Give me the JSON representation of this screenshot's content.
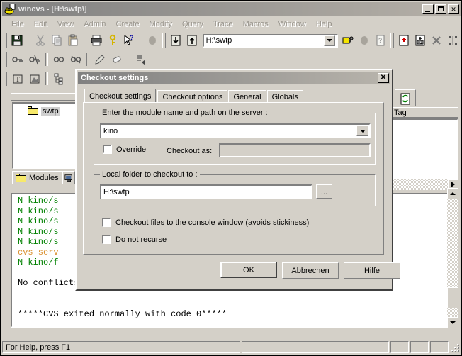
{
  "window": {
    "title": "wincvs - [H:\\swtp\\]",
    "app_icon": "wincvs-frog-icon",
    "minimize_label": "_",
    "maximize_label": "□",
    "close_label": "✕"
  },
  "menubar": {
    "items": [
      {
        "label": "File"
      },
      {
        "label": "Edit"
      },
      {
        "label": "View"
      },
      {
        "label": "Admin"
      },
      {
        "label": "Create"
      },
      {
        "label": "Modify"
      },
      {
        "label": "Query"
      },
      {
        "label": "Trace"
      },
      {
        "label": "Macros"
      },
      {
        "label": "Window"
      },
      {
        "label": "Help"
      }
    ]
  },
  "toolbar": {
    "row1": [
      {
        "icon": "save-icon",
        "name": "save-button"
      },
      {
        "icon": "cut-icon",
        "name": "cut-button"
      },
      {
        "icon": "copy-icon",
        "name": "copy-button"
      },
      {
        "icon": "paste-icon",
        "name": "paste-button"
      },
      {
        "icon": "print-icon",
        "name": "print-button"
      },
      {
        "icon": "about-key-icon",
        "name": "about-button"
      },
      {
        "icon": "help-pointer-icon",
        "name": "context-help-button"
      },
      {
        "icon": "stop-icon",
        "name": "stop-button"
      },
      {
        "icon": "checkout-down-icon",
        "name": "checkout-button"
      },
      {
        "icon": "commit-up-icon",
        "name": "commit-button"
      },
      {
        "icon": "browse-folder-icon",
        "name": "browse-folder-button"
      },
      {
        "icon": "stop2-icon",
        "name": "stop-alt-button"
      },
      {
        "icon": "query-icon",
        "name": "query-button"
      },
      {
        "icon": "add-icon",
        "name": "add-button"
      },
      {
        "icon": "add-binary-icon",
        "name": "add-binary-button"
      },
      {
        "icon": "remove-x-icon",
        "name": "remove-button"
      },
      {
        "icon": "graph-icon",
        "name": "graph-button"
      }
    ],
    "row2": [
      {
        "icon": "watch-on-icon",
        "name": "watch-on-button"
      },
      {
        "icon": "watch-off-icon",
        "name": "watch-off-button"
      },
      {
        "icon": "edit-glasses-icon",
        "name": "watchers-button"
      },
      {
        "icon": "unedit-glasses-icon",
        "name": "editors-button"
      },
      {
        "icon": "edit-pencil-icon",
        "name": "edit-button"
      },
      {
        "icon": "unedit-eraser-icon",
        "name": "unedit-button"
      },
      {
        "icon": "edit-list-icon",
        "name": "edit-list-button"
      }
    ],
    "row3": [
      {
        "icon": "text-t-icon",
        "name": "text-mode-button"
      },
      {
        "icon": "image-icon",
        "name": "image-mode-button"
      },
      {
        "icon": "tree-icon",
        "name": "tree-view-button"
      }
    ],
    "address": {
      "value": "H:\\swtp",
      "placeholder": ""
    }
  },
  "tree_panel": {
    "root_node": "swtp",
    "tabs": [
      {
        "label": "Modules",
        "icon": "folder-icon",
        "selected": true
      },
      {
        "label": "",
        "icon": "monitor-icon",
        "selected": false
      }
    ]
  },
  "tag_panel": {
    "tab_icon": "refresh-doc-icon",
    "column_header": "Tag",
    "rows": []
  },
  "console": {
    "lines": [
      {
        "text": "N kino/s",
        "color": "green"
      },
      {
        "text": "N kino/s",
        "color": "green"
      },
      {
        "text": "N kino/s",
        "color": "green"
      },
      {
        "text": "N kino/s",
        "color": "green"
      },
      {
        "text": "N kino/s",
        "color": "green"
      },
      {
        "text": "cvs serv",
        "color": "orange"
      },
      {
        "text": "N kino/f",
        "color": "green"
      },
      {
        "text": "",
        "color": "black"
      },
      {
        "text": "No conflicts created by this import",
        "color": "black"
      },
      {
        "text": "",
        "color": "black"
      },
      {
        "text": "",
        "color": "black"
      },
      {
        "text": "*****CVS exited normally with code 0*****",
        "color": "black"
      }
    ]
  },
  "dialog": {
    "title": "Checkout settings",
    "close_label": "✕",
    "tabs": [
      {
        "label": "Checkout settings",
        "selected": true
      },
      {
        "label": "Checkout options",
        "selected": false
      },
      {
        "label": "General",
        "selected": false
      },
      {
        "label": "Globals",
        "selected": false
      }
    ],
    "module_group": {
      "legend": "Enter the module name and path on the server :",
      "module_value": "kino",
      "module_placeholder": "",
      "override_label": "Override",
      "override_checked": false,
      "checkout_as_label": "Checkout as:",
      "checkout_as_value": "",
      "checkout_as_placeholder": ""
    },
    "folder_group": {
      "legend": "Local folder to checkout to :",
      "folder_value": "H:\\swtp",
      "folder_placeholder": "",
      "browse_label": "..."
    },
    "options": [
      {
        "label": "Checkout files to the console window (avoids stickiness)",
        "checked": false
      },
      {
        "label": "Do not recurse",
        "checked": false
      }
    ],
    "buttons": {
      "ok": "OK",
      "cancel": "Abbrechen",
      "help": "Hilfe"
    }
  },
  "statusbar": {
    "text": "For Help, press F1",
    "panes": [
      "",
      "",
      "",
      ""
    ]
  },
  "colors": {
    "face": "#d4d0c8",
    "title_inactive_start": "#808080",
    "title_inactive_end": "#b5b0a8",
    "console_green": "#008000",
    "console_orange": "#d98e2b",
    "folder_yellow": "#f7e96b"
  }
}
